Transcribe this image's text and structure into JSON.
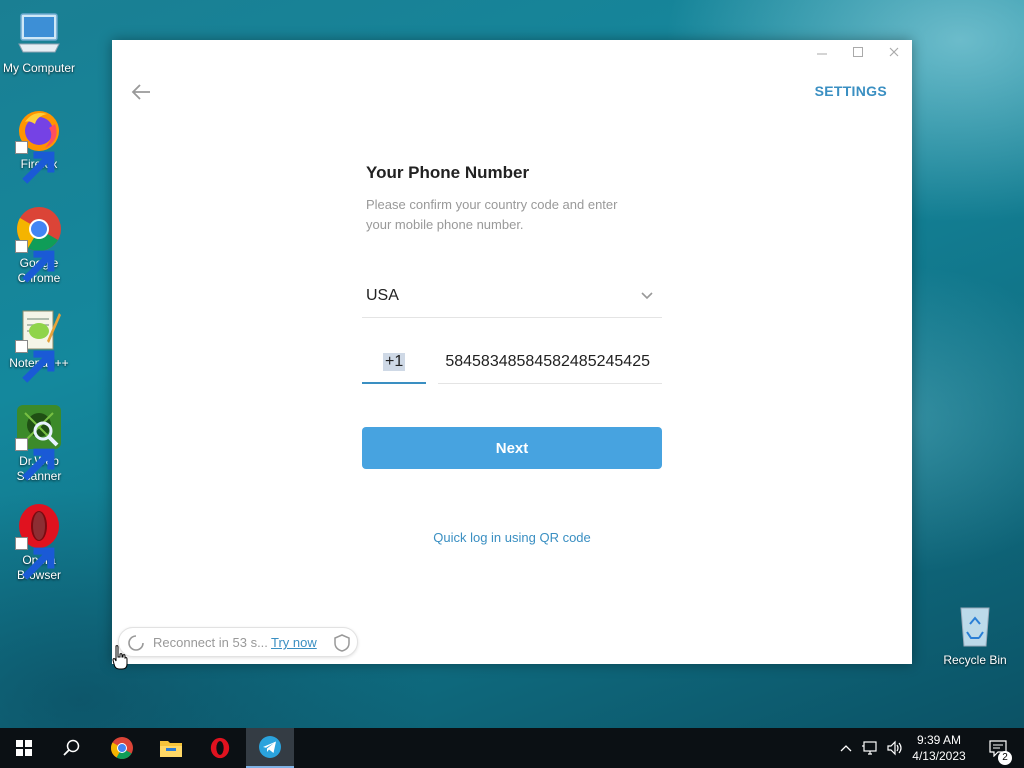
{
  "desktop": {
    "icons": [
      {
        "label": "My Computer"
      },
      {
        "label": "Firefox"
      },
      {
        "label": "Google Chrome"
      },
      {
        "label": "Notepad++"
      },
      {
        "label": "Dr.Web Scanner"
      },
      {
        "label": "Opera Browser"
      },
      {
        "label": "Recycle Bin"
      }
    ]
  },
  "window": {
    "settings_label": "SETTINGS",
    "title": "Your Phone Number",
    "subtitle": "Please confirm your country code and enter your mobile phone number.",
    "country": "USA",
    "country_code": "+1",
    "phone_value": "5845834858458248524542​5",
    "next_label": "Next",
    "qr_link": "Quick log in using QR code",
    "reconnect_text": "Reconnect in 53 s...",
    "try_now": "Try now",
    "accent_color": "#47a3e0"
  },
  "taskbar": {
    "time": "9:39 AM",
    "date": "4/13/2023",
    "notification_count": "2"
  }
}
